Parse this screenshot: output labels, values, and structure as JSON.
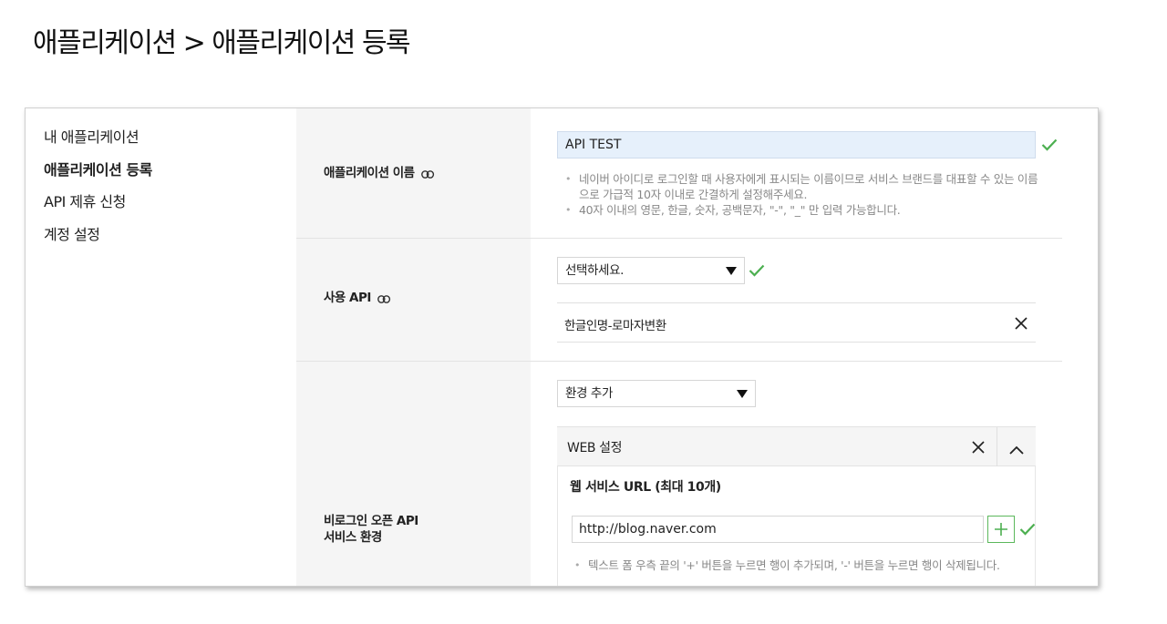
{
  "page": {
    "title": "애플리케이션 > 애플리케이션 등록"
  },
  "sidebar": {
    "items": [
      {
        "label": "내 애플리케이션"
      },
      {
        "label": "애플리케이션 등록"
      },
      {
        "label": "API 제휴 신청"
      },
      {
        "label": "계정 설정"
      }
    ]
  },
  "form": {
    "app_name": {
      "label": "애플리케이션 이름",
      "value": "API TEST",
      "help_1": "네이버 아이디로 로그인할 때 사용자에게 표시되는 이름이므로 서비스 브랜드를 대표할 수 있는 이름으로 가급적 10자 이내로 간결하게 설정해주세요.",
      "help_2": "40자 이내의 영문, 한글, 숫자, 공백문자, \"-\", \"_\" 만 입력 가능합니다."
    },
    "api": {
      "label": "사용 API",
      "select_value": "선택하세요.",
      "selected_item": "한글인명-로마자변환"
    },
    "env": {
      "label_line1": "비로그인 오픈 API",
      "label_line2": "서비스 환경",
      "add_select": "환경 추가",
      "web_title": "WEB 설정",
      "url_title": "웹 서비스 URL (최대 10개)",
      "url_value": "http://blog.naver.com",
      "help": "텍스트 폼 우측 끝의 '+' 버튼을 누르면 행이 추가되며, '-' 버튼을 누르면 행이 삭제됩니다."
    }
  },
  "colors": {
    "check": "#4caf50",
    "input_bg": "#e6f0fb",
    "label_col_bg": "#f5f5f5"
  }
}
